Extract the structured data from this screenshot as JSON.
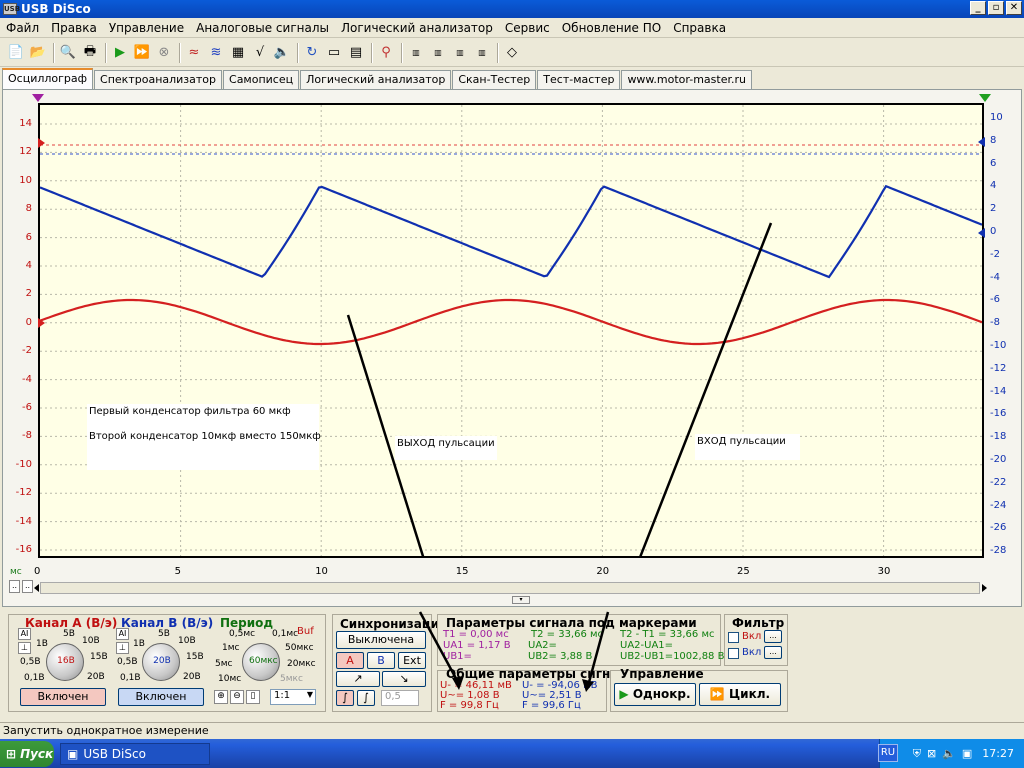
{
  "window": {
    "title": "USB DiSco"
  },
  "menu": [
    "Файл",
    "Правка",
    "Управление",
    "Аналоговые сигналы",
    "Логический анализатор",
    "Сервис",
    "Обновление ПО",
    "Справка"
  ],
  "tabs": [
    "Осциллограф",
    "Спектроанализатор",
    "Самописец",
    "Логический анализатор",
    "Скан-Тестер",
    "Тест-мастер",
    "www.motor-master.ru"
  ],
  "plot": {
    "left_ticks": [
      "14",
      "12",
      "10",
      "8",
      "6",
      "4",
      "2",
      "0",
      "-2",
      "-4",
      "-6",
      "-8",
      "-10",
      "-12",
      "-14",
      "-16"
    ],
    "right_ticks": [
      "10",
      "8",
      "6",
      "4",
      "2",
      "0",
      "-2",
      "-4",
      "-6",
      "-8",
      "-10",
      "-12",
      "-14",
      "-16",
      "-18",
      "-20",
      "-22",
      "-24",
      "-26",
      "-28"
    ],
    "x_ticks": [
      "0",
      "5",
      "10",
      "15",
      "20",
      "25",
      "30"
    ],
    "x_unit": "мс",
    "note1_line1": "Первый конденсатор фильтра 60 мкф",
    "note1_line2": "Второй конденсатор  10мкф вместо 150мкф",
    "note2": "ВЫХОД пульсации",
    "note3": "ВХОД  пульсации",
    "colors": {
      "channel_a": "#d42020",
      "channel_b": "#1030b0"
    }
  },
  "chan_a": {
    "title": "Канал А (В/э)",
    "knob": "16В",
    "labels": [
      "5В",
      "10В",
      "1В",
      "15В",
      "0,5В",
      "0,1В",
      "20В"
    ],
    "button": "Включен"
  },
  "chan_b": {
    "title": "Канал В (В/э)",
    "knob": "20В",
    "labels": [
      "5В",
      "10В",
      "1В",
      "15В",
      "0,5В",
      "0,1В",
      "20В"
    ],
    "button": "Включен"
  },
  "period": {
    "title": "Период",
    "buf": "Buf",
    "knob": "60мкс",
    "labels": [
      "0,5мс",
      "0,1мс",
      "1мс",
      "50мкс",
      "5мс",
      "20мкс",
      "10мс",
      "5мкс"
    ],
    "ratio": "1:1"
  },
  "sync": {
    "title": "Синхронизация",
    "off": "Выключена",
    "a": "A",
    "b": "B",
    "ext": "Ext",
    "level": "0,5"
  },
  "markers": {
    "title": "Параметры сигнала под маркерами",
    "t1": "T1 = 0,00 мс",
    "t2": "T2 = 33,66 мс",
    "dt": "T2 - T1 = 33,66 мс",
    "ua1": "UA1 = 1,17 В",
    "ua2": "UA2=",
    "ua21": "UA2-UA1=",
    "ub1": "UB1=",
    "ub2": "UB2= 3,88 В",
    "ub21": "UB2-UB1=1002,88 В"
  },
  "filter": {
    "title": "Фильтр",
    "on": "Вкл",
    "dots": "..."
  },
  "general": {
    "title": "Общие параметры сигнала",
    "a_dc": "U- = 46,11 мВ",
    "a_ac": "U~= 1,08 В",
    "a_f": "F = 99,8 Гц",
    "b_dc": "U- = -94,06 мВ",
    "b_ac": "U~= 2,51 В",
    "b_f": "F = 99,6 Гц"
  },
  "control": {
    "title": "Управление",
    "single": "Однокр.",
    "cycle": "Цикл."
  },
  "status": "Запустить однократное измерение",
  "taskbar": {
    "start": "Пуск",
    "app": "USB DiSco",
    "lang": "RU",
    "time": "17:27"
  }
}
